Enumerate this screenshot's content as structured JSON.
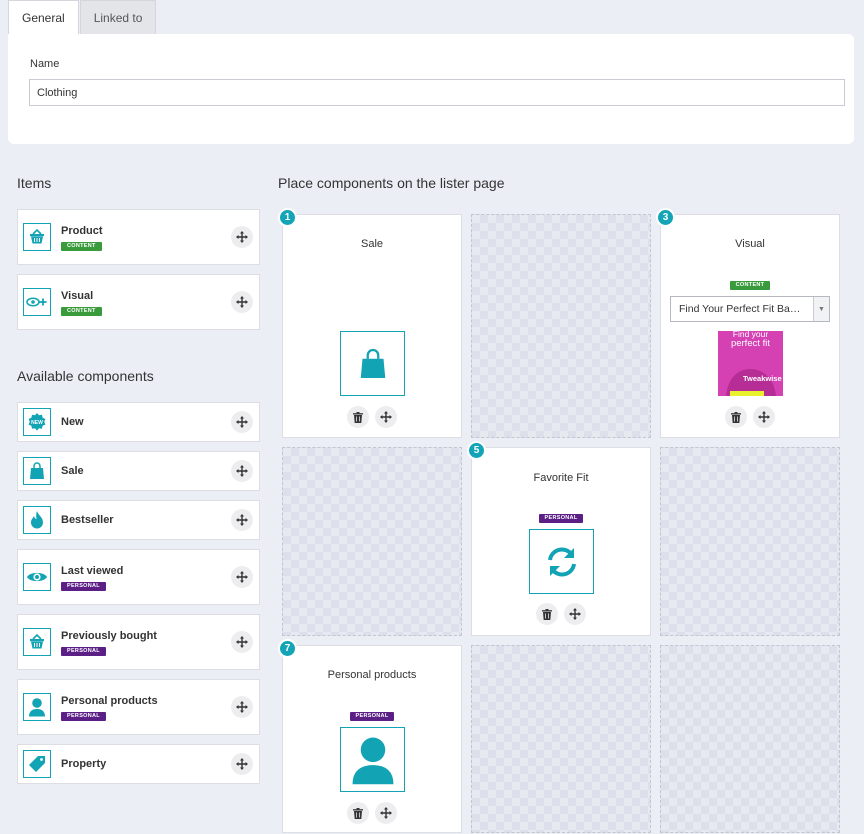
{
  "tabs": [
    {
      "label": "General"
    },
    {
      "label": "Linked to"
    }
  ],
  "name_field": {
    "label": "Name",
    "value": "Clothing"
  },
  "sections": {
    "items": "Items",
    "available": "Available components",
    "place": "Place components on the lister page"
  },
  "items": [
    {
      "label": "Product",
      "badge": "CONTENT",
      "icon": "basket-icon"
    },
    {
      "label": "Visual",
      "badge": "CONTENT",
      "icon": "eye-plus-icon"
    }
  ],
  "available": [
    {
      "label": "New",
      "badge": null,
      "icon": "new-seal-icon"
    },
    {
      "label": "Sale",
      "badge": null,
      "icon": "shopping-bag-icon"
    },
    {
      "label": "Bestseller",
      "badge": null,
      "icon": "flame-icon"
    },
    {
      "label": "Last viewed",
      "badge": "PERSONAL",
      "icon": "eye-icon"
    },
    {
      "label": "Previously bought",
      "badge": "PERSONAL",
      "icon": "basket-icon"
    },
    {
      "label": "Personal products",
      "badge": "PERSONAL",
      "icon": "person-icon"
    },
    {
      "label": "Property",
      "badge": null,
      "icon": "tag-icon"
    }
  ],
  "grid": {
    "slot1": {
      "number": "1",
      "title": "Sale",
      "icon": "shopping-bag-icon"
    },
    "slot3": {
      "number": "3",
      "title": "Visual",
      "badge": "CONTENT",
      "select_value": "Find Your Perfect Fit Ba…",
      "thumb_text_top": "Find your",
      "thumb_text_mid": "perfect fit",
      "thumb_brand": "Tweakwise"
    },
    "slot5": {
      "number": "5",
      "title": "Favorite Fit",
      "badge": "PERSONAL",
      "icon": "refresh-icon"
    },
    "slot7": {
      "number": "7",
      "title": "Personal products",
      "badge": "PERSONAL",
      "icon": "person-icon"
    }
  },
  "colors": {
    "accent": "#13a5b7",
    "content_badge": "#3a9b3c",
    "personal_badge": "#5b1f86"
  }
}
